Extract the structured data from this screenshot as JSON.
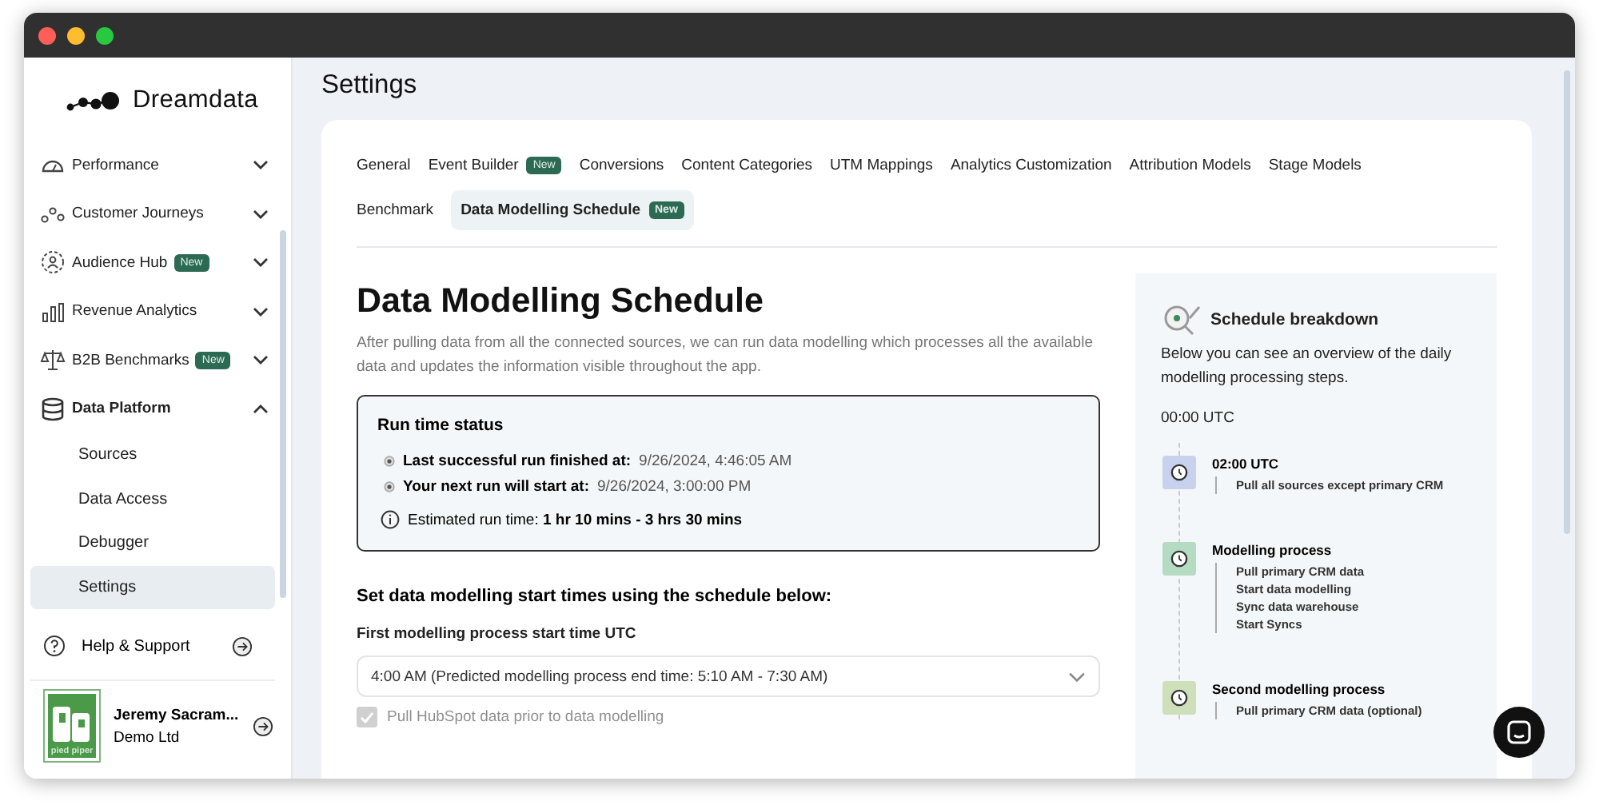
{
  "brand": {
    "name": "Dreamdata"
  },
  "sidebar": {
    "items": [
      {
        "label": "Performance",
        "expanded": false
      },
      {
        "label": "Customer Journeys",
        "expanded": false
      },
      {
        "label": "Audience Hub",
        "badge": "New",
        "expanded": false
      },
      {
        "label": "Revenue Analytics",
        "expanded": false
      },
      {
        "label": "B2B Benchmarks",
        "badge": "New",
        "expanded": false
      },
      {
        "label": "Data Platform",
        "expanded": true,
        "children": [
          {
            "label": "Sources",
            "selected": false
          },
          {
            "label": "Data Access",
            "selected": false
          },
          {
            "label": "Debugger",
            "selected": false
          },
          {
            "label": "Settings",
            "selected": true
          }
        ]
      }
    ],
    "help": "Help & Support",
    "user": {
      "name": "Jeremy Sacram...",
      "company": "Demo Ltd",
      "logo_text": "pied piper"
    }
  },
  "page": {
    "title": "Settings"
  },
  "tabs": [
    {
      "label": "General",
      "selected": false
    },
    {
      "label": "Event Builder",
      "badge": "New",
      "selected": false
    },
    {
      "label": "Conversions",
      "selected": false
    },
    {
      "label": "Content Categories",
      "selected": false
    },
    {
      "label": "UTM Mappings",
      "selected": false
    },
    {
      "label": "Analytics Customization",
      "selected": false
    },
    {
      "label": "Attribution Models",
      "selected": false
    },
    {
      "label": "Stage Models",
      "selected": false
    },
    {
      "label": "Benchmark",
      "selected": false
    },
    {
      "label": "Data Modelling Schedule",
      "badge": "New",
      "selected": true
    }
  ],
  "content": {
    "title": "Data Modelling Schedule",
    "description": "After pulling data from all the connected sources, we can run data modelling which processes all the available data and updates the information visible throughout the app.",
    "status": {
      "title": "Run time status",
      "runs": [
        {
          "label": "Last successful run finished at:",
          "value": "9/26/2024, 4:46:05 AM"
        },
        {
          "label": "Your next run will start at:",
          "value": "9/26/2024, 3:00:00 PM"
        }
      ],
      "estimate": "Estimated run time: **1 hr 10 mins - 3 hrs 30 mins**"
    },
    "schedule_heading": "Set data modelling start times using the schedule below:",
    "field_label": "First modelling process start time UTC",
    "select_value": "4:00 AM (Predicted modelling process end time: 5:10 AM - 7:30 AM)",
    "checkbox": {
      "label": "Pull HubSpot data prior to data modelling",
      "checked": true,
      "disabled": true
    }
  },
  "breakdown": {
    "title": "Schedule breakdown",
    "description": "Below you can see an overview of the daily modelling processing steps.",
    "start": "00:00 UTC",
    "steps": [
      {
        "title": "02:00 UTC",
        "color": "#c8d2ee",
        "items": [
          "Pull all sources except primary CRM"
        ]
      },
      {
        "title": "Modelling process",
        "color": "#b5dbc3",
        "items": [
          "Pull primary CRM data",
          "Start data modelling",
          "Sync data warehouse",
          "Start Syncs"
        ]
      },
      {
        "title": "Second modelling process",
        "color": "#cde0b9",
        "items": [
          "Pull primary CRM data (optional)"
        ]
      }
    ]
  }
}
